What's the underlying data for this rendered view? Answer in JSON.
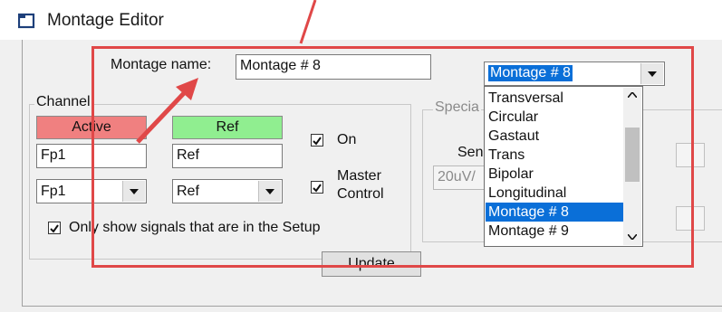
{
  "window": {
    "title": "Montage Editor",
    "icon": "montage-editor-icon"
  },
  "montage_name": {
    "label": "Montage name:",
    "value": "Montage # 8",
    "combo_value": "Montage # 8",
    "options": [
      "Transversal",
      "Circular",
      "Gastaut",
      "Trans",
      "Bipolar",
      "Longitudinal",
      "Montage # 8",
      "Montage # 9"
    ],
    "selected_index": 6
  },
  "channel": {
    "group_label": "Channel",
    "active_header": "Active",
    "ref_header": "Ref",
    "active_value": "Fp1",
    "ref_value": "Ref",
    "active_combo": "Fp1",
    "ref_combo": "Ref",
    "on_label": "On",
    "on_checked": true,
    "master_control_line1": "Master",
    "master_control_line2": "Control",
    "master_control_checked": true,
    "only_show_label": "Only show signals that are in the Setup",
    "only_show_checked": true
  },
  "special": {
    "group_label": "Specia",
    "sens_label": "Sen",
    "sens_value": "20uV/"
  },
  "update_label": "Update",
  "colors": {
    "active_header_bg": "#f08080",
    "ref_header_bg": "#90ee90",
    "selection": "#0a6fd8",
    "annotation": "#e04848"
  }
}
